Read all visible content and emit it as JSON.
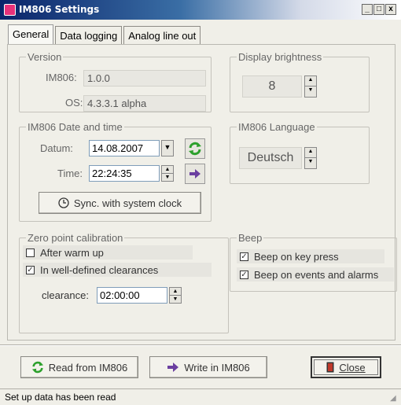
{
  "window": {
    "title": "IM806 Settings",
    "min": "_",
    "max": "□",
    "close": "x"
  },
  "tabs": [
    {
      "label": "General",
      "active": true
    },
    {
      "label": "Data logging",
      "active": false
    },
    {
      "label": "Analog line out",
      "active": false
    }
  ],
  "version": {
    "legend": "Version",
    "im806_label": "IM806:",
    "im806_value": "1.0.0",
    "os_label": "OS:",
    "os_value": "4.3.3.1 alpha"
  },
  "brightness": {
    "legend": "Display brightness",
    "value": "8"
  },
  "datetime": {
    "legend": "IM806 Date and time",
    "date_label": "Datum:",
    "date_value": "14.08.2007",
    "time_label": "Time:",
    "time_value": "22:24:35",
    "sync_label": "Sync. with system clock"
  },
  "language": {
    "legend": "IM806 Language",
    "value": "Deutsch"
  },
  "zero": {
    "legend": "Zero point calibration",
    "opt1": "After warm up",
    "opt1_checked": false,
    "opt2": "In well-defined clearances",
    "opt2_checked": true,
    "clearance_label": "clearance:",
    "clearance_value": "02:00:00"
  },
  "beep": {
    "legend": "Beep",
    "opt1": "Beep on key press",
    "opt1_checked": true,
    "opt2": "Beep on events and alarms",
    "opt2_checked": true
  },
  "buttons": {
    "read": "Read from IM806",
    "write": "Write in IM806",
    "close": "Close"
  },
  "status": "Set up data has been read",
  "colors": {
    "refresh_icon": "#2ca02c",
    "arrow_icon": "#6b3fa0",
    "clock_icon": "#333333"
  }
}
